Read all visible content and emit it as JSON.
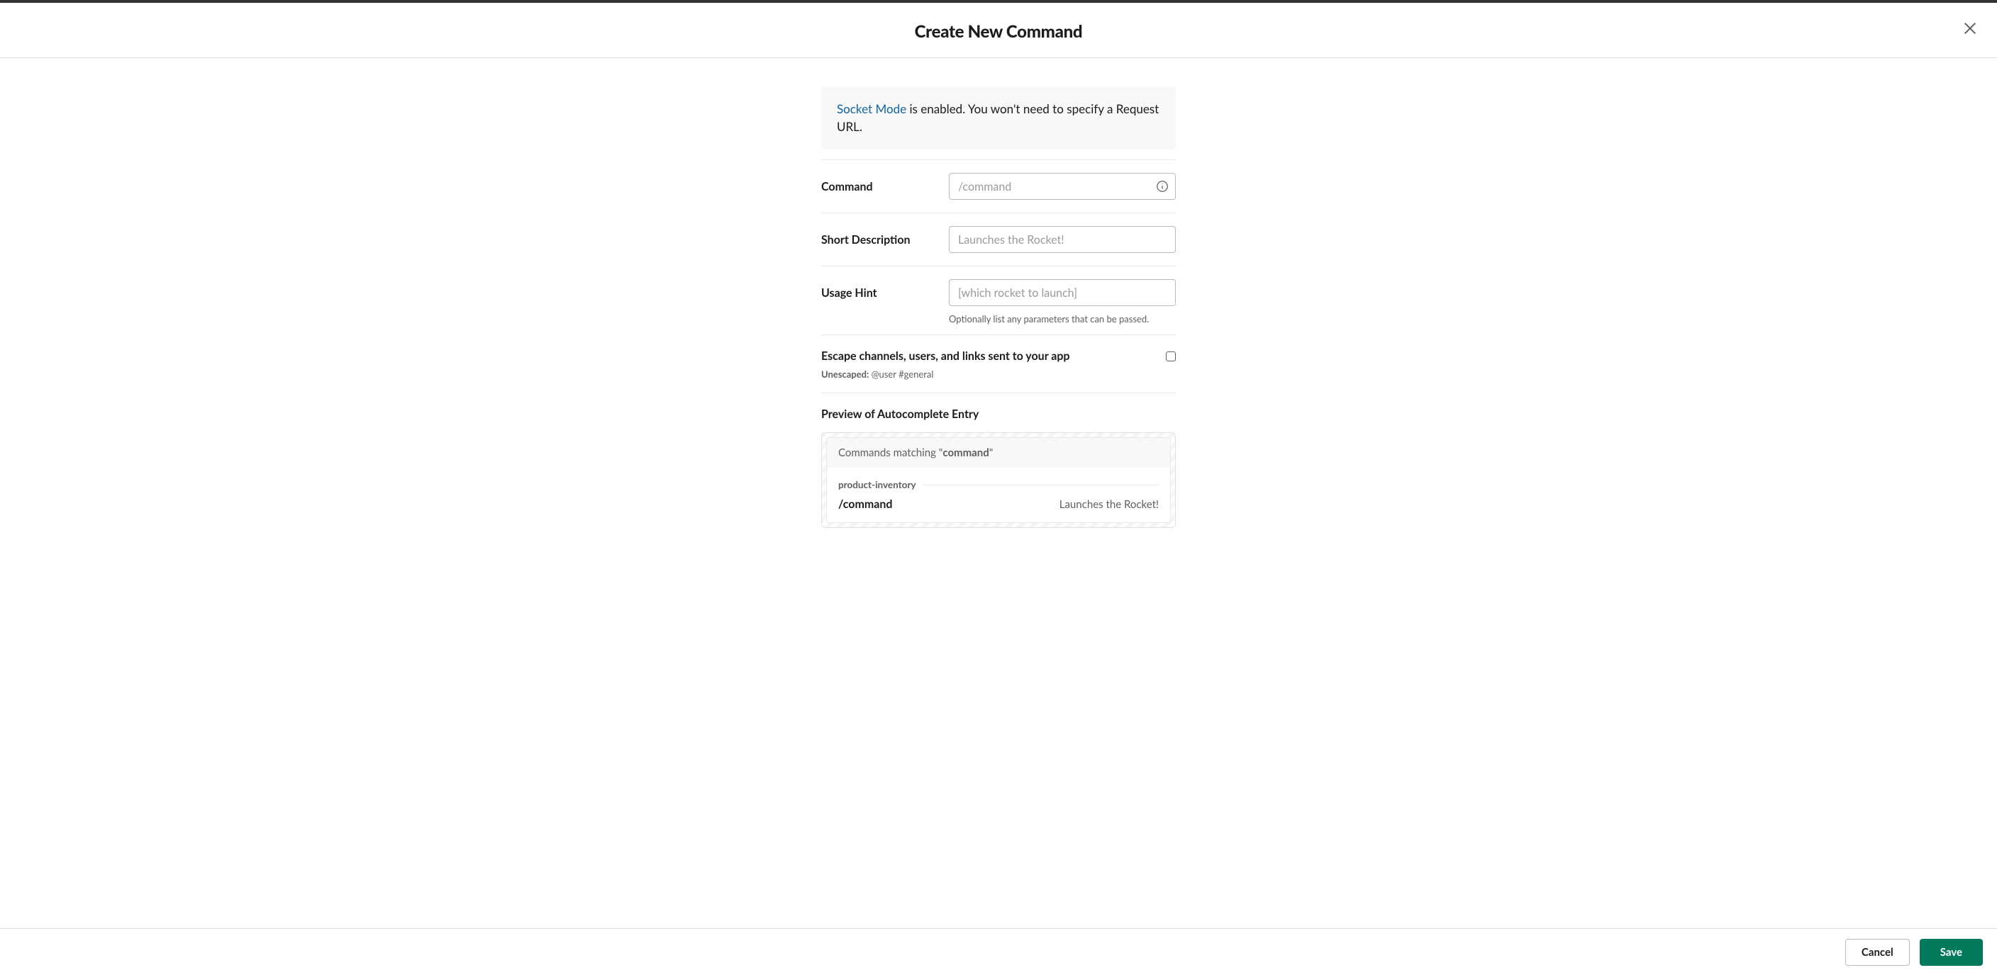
{
  "header": {
    "title": "Create New Command"
  },
  "banner": {
    "link_text": "Socket Mode",
    "rest_text": " is enabled. You won't need to specify a Request URL."
  },
  "fields": {
    "command": {
      "label": "Command",
      "placeholder": "/command"
    },
    "short_description": {
      "label": "Short Description",
      "placeholder": "Launches the Rocket!"
    },
    "usage_hint": {
      "label": "Usage Hint",
      "placeholder": "[which rocket to launch]",
      "help": "Optionally list any parameters that can be passed."
    }
  },
  "escape": {
    "label": "Escape channels, users, and links sent to your app",
    "note_prefix": "Unescaped:",
    "note_example": " @user #general"
  },
  "preview": {
    "title": "Preview of Autocomplete Entry",
    "header_prefix": "Commands matching \"",
    "header_keyword": "command",
    "header_suffix": "\"",
    "group_name": "product-inventory",
    "command_name": "/command",
    "command_desc": "Launches the Rocket!"
  },
  "footer": {
    "cancel": "Cancel",
    "save": "Save"
  }
}
